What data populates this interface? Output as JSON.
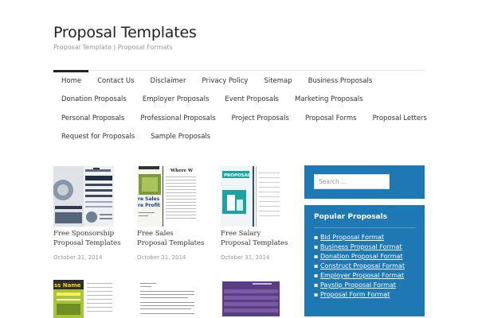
{
  "site": {
    "title": "Proposal Templates",
    "description": "Proposal Template | Proposal Formats"
  },
  "nav": {
    "row1": [
      "Home",
      "Contact Us",
      "Disclaimer",
      "Privacy Policy",
      "Sitemap",
      "Business Proposals"
    ],
    "row2": [
      "Donation Proposals",
      "Employer Proposals",
      "Event Proposals",
      "Marketing Proposals"
    ],
    "row3": [
      "Personal Proposals",
      "Professional Proposals",
      "Project Proposals",
      "Proposal Forms",
      "Proposal Letters"
    ],
    "row4": [
      "Request for Proposals",
      "Sample Proposals"
    ]
  },
  "posts": [
    {
      "title": "Free Sponsorship Proposal Templates",
      "date": "October 31, 2014"
    },
    {
      "title": "Free Sales Proposal Templates",
      "date": "October 31, 2014"
    },
    {
      "title": "Free Salary Proposal Templates",
      "date": "October 31, 2014"
    }
  ],
  "thumb_text": {
    "sales_line1": "re Sales",
    "sales_line2": "re Profit",
    "sales_header": "Where W",
    "salary_label": "PROPOSAL",
    "row2_label": "ss Name"
  },
  "sidebar": {
    "search_placeholder": "Search ...",
    "popular_title": "Popular Proposals",
    "popular_items": [
      "Bid Proposal Format",
      "Business Proposal Format",
      "Donation Proposal Format",
      "Construct Proposal Format",
      "Employer Proposal Format",
      "Payslip Proposal Format",
      "Proposal Form Format"
    ]
  },
  "colors": {
    "widget_bg": "#1e78b4",
    "accent_teal": "#1aa3a3"
  }
}
